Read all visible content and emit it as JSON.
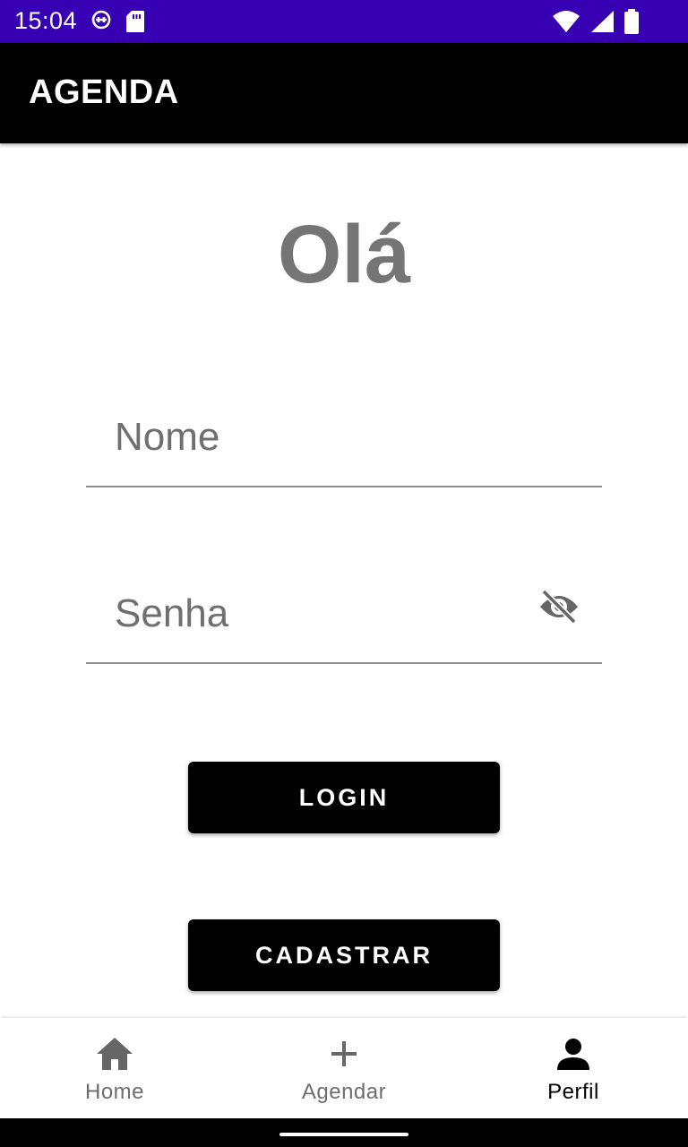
{
  "status_bar": {
    "time": "15:04",
    "background": "#3700b3",
    "left_icons": [
      "vpn-key-icon",
      "sd-card-icon"
    ],
    "right_icons": [
      "wifi-icon",
      "signal-icon",
      "battery-icon"
    ]
  },
  "app_bar": {
    "title": "AGENDA",
    "background": "#000000"
  },
  "main": {
    "greeting": "Olá",
    "name_field": {
      "placeholder": "Nome",
      "value": ""
    },
    "password_field": {
      "placeholder": "Senha",
      "value": "",
      "toggle_icon": "visibility-off-icon"
    },
    "login_label": "LOGIN",
    "register_label": "CADASTRAR"
  },
  "bottom_nav": {
    "items": [
      {
        "label": "Home",
        "icon": "home-icon",
        "active": false
      },
      {
        "label": "Agendar",
        "icon": "add-icon",
        "active": false
      },
      {
        "label": "Perfil",
        "icon": "person-icon",
        "active": true
      }
    ]
  }
}
